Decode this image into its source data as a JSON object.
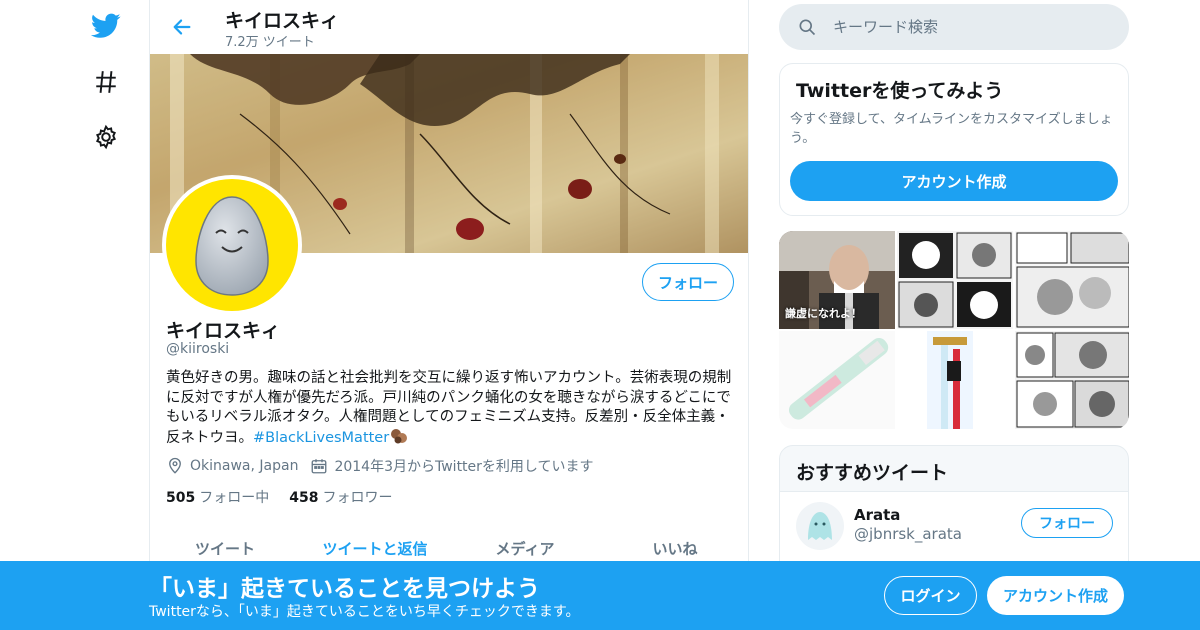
{
  "header": {
    "title": "キイロスキィ",
    "tweet_count": "7.2万 ツイート"
  },
  "profile": {
    "name": "キイロスキィ",
    "handle": "@kiiroski",
    "bio": "黄色好きの男。趣味の話と社会批判を交互に繰り返す怖いアカウント。芸術表現の規制に反対ですが人権が優先だろ派。戸川純のパンク蛹化の女を聴きながら涙するどこにでもいるリベラル派オタク。人権問題としてのフェミニズム支持。反差別・反全体主義・反ネトウヨ。",
    "hashtag": "#BlackLivesMatter",
    "location": "Okinawa, Japan",
    "joined": "2014年3月からTwitterを利用しています",
    "following_count": "505",
    "following_label": "フォロー中",
    "followers_count": "458",
    "followers_label": "フォロワー",
    "follow_label": "フォロー"
  },
  "tabs": [
    {
      "label": "ツイート"
    },
    {
      "label": "ツイートと返信"
    },
    {
      "label": "メディア"
    },
    {
      "label": "いいね"
    }
  ],
  "search": {
    "placeholder": "キーワード検索"
  },
  "signup_card": {
    "title": "Twitterを使ってみよう",
    "description": "今すぐ登録して、タイムラインをカスタマイズしましょう。",
    "button": "アカウント作成"
  },
  "media": {
    "caption": "謙虚になれよ！"
  },
  "recommended": {
    "title": "おすすめツイート",
    "name": "Arata",
    "handle": "@jbnrsk_arata",
    "follow_label": "フォロー"
  },
  "bottom_bar": {
    "title": "「いま」起きていることを見つけよう",
    "subtitle": "Twitterなら、「いま」起きていることをいち早くチェックできます。",
    "login": "ログイン",
    "signup": "アカウント作成"
  },
  "colors": {
    "accent": "#1da1f2",
    "avatar_bg": "#ffe500",
    "secondary_text": "#657786"
  }
}
